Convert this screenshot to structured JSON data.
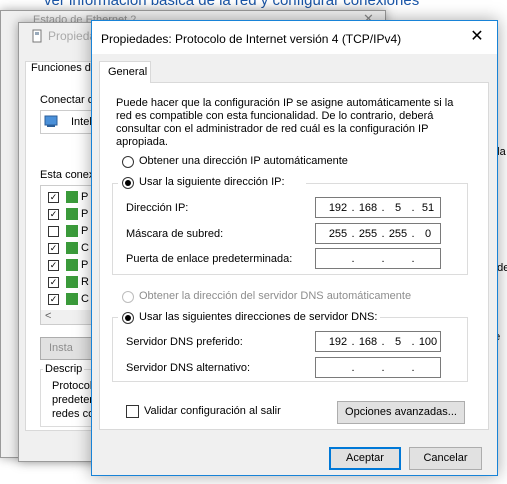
{
  "background": {
    "heading": "ver información básica de la red y configurar conexiones",
    "side_texts": [
      "a la",
      "n de",
      "de"
    ]
  },
  "win1": {
    "title": "Estado de Ethernet 2",
    "close": "✕"
  },
  "win2": {
    "title": "Propiedades",
    "tab": "Funciones d",
    "connect_label": "Conectar c",
    "adapter_text": "Intel",
    "items_label": "Esta conex",
    "items": [
      {
        "checked": true,
        "text": "P"
      },
      {
        "checked": true,
        "text": "P"
      },
      {
        "checked": false,
        "text": "P"
      },
      {
        "checked": true,
        "text": "C"
      },
      {
        "checked": true,
        "text": "P"
      },
      {
        "checked": true,
        "text": "R"
      },
      {
        "checked": true,
        "text": "C"
      }
    ],
    "scroll_left": "<",
    "install_button": "Insta",
    "description_title": "Descrip",
    "description_lines": [
      "Protocolo",
      "predeter",
      "redes co"
    ]
  },
  "dialog": {
    "title": "Propiedades: Protocolo de Internet versión 4 (TCP/IPv4)",
    "close": "✕",
    "tab": "General",
    "description": "Puede hacer que la configuración IP se asigne automáticamente si la red es compatible con esta funcionalidad. De lo contrario, deberá consultar con el administrador de red cuál es la configuración IP apropiada.",
    "ip_auto": {
      "label": "Obtener una dirección IP automáticamente",
      "selected": false
    },
    "ip_manual": {
      "label": "Usar la siguiente dirección IP:",
      "selected": true
    },
    "ip_fields": [
      {
        "label": "Dirección IP:",
        "octets": [
          "192",
          "168",
          "5",
          "51"
        ]
      },
      {
        "label": "Máscara de subred:",
        "octets": [
          "255",
          "255",
          "255",
          "0"
        ]
      },
      {
        "label": "Puerta de enlace predeterminada:",
        "octets": [
          "",
          "",
          "",
          ""
        ]
      }
    ],
    "dns_auto": {
      "label": "Obtener la dirección del servidor DNS automáticamente",
      "selected": false,
      "disabled": true
    },
    "dns_manual": {
      "label": "Usar las siguientes direcciones de servidor DNS:",
      "selected": true
    },
    "dns_fields": [
      {
        "label": "Servidor DNS preferido:",
        "octets": [
          "192",
          "168",
          "5",
          "100"
        ]
      },
      {
        "label": "Servidor DNS alternativo:",
        "octets": [
          "",
          "",
          "",
          ""
        ]
      }
    ],
    "validate": {
      "label": "Validar configuración al salir",
      "checked": false
    },
    "advanced_button": "Opciones avanzadas...",
    "accept_button": "Aceptar",
    "cancel_button": "Cancelar"
  },
  "colors": {
    "accent": "#0078d7",
    "link": "#1a56a8"
  }
}
